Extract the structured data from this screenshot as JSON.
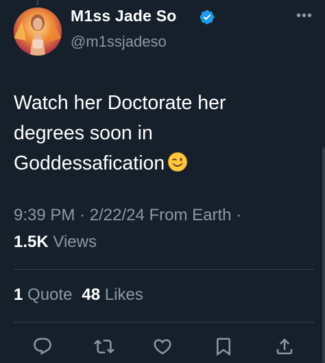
{
  "tweet": {
    "author": {
      "display_name": "M1ss Jade So",
      "handle": "@m1ssjadeso",
      "verified": true,
      "avatar": "profile-photo"
    },
    "text_lines": [
      "Watch her Doctorate her",
      "degrees soon in",
      "Goddessafication"
    ],
    "emoji": "winking-face",
    "meta": {
      "time": "9:39 PM",
      "date": "2/22/24",
      "source": "From Earth",
      "separator": "·"
    },
    "views": {
      "count": "1.5K",
      "label": "Views"
    },
    "stats": {
      "quotes_count": "1",
      "quotes_label": "Quote",
      "likes_count": "48",
      "likes_label": "Likes"
    }
  },
  "icons": {
    "more": "more-icon",
    "verified": "verified-badge-icon",
    "reply": "reply-icon",
    "retweet": "retweet-icon",
    "like": "like-icon",
    "bookmark": "bookmark-icon",
    "share": "share-icon"
  },
  "colors": {
    "background": "#15202b",
    "primary_text": "#ffffff",
    "secondary_text": "#8b98a5",
    "divider": "#38444d",
    "verified_blue": "#1d9bf0"
  }
}
